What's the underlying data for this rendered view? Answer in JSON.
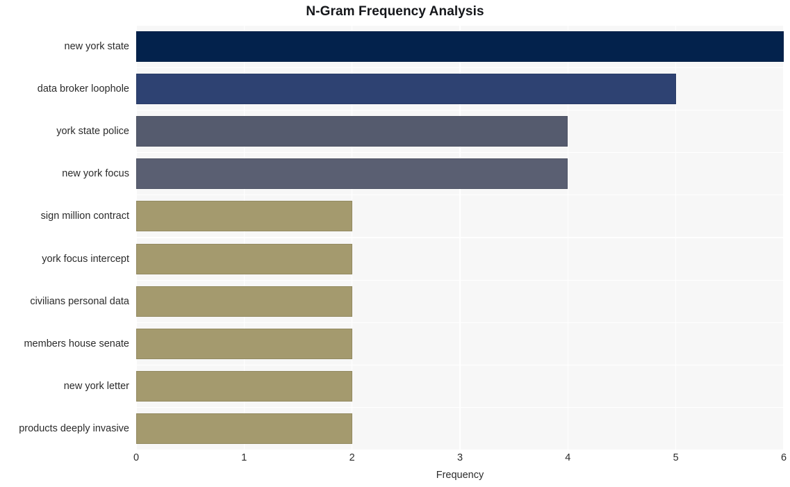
{
  "chart_data": {
    "type": "bar",
    "orientation": "horizontal",
    "title": "N-Gram Frequency Analysis",
    "xlabel": "Frequency",
    "ylabel": "",
    "categories": [
      "new york state",
      "data broker loophole",
      "york state police",
      "new york focus",
      "sign million contract",
      "york focus intercept",
      "civilians personal data",
      "members house senate",
      "new york letter",
      "products deeply invasive"
    ],
    "values": [
      6,
      5,
      4,
      4,
      2,
      2,
      2,
      2,
      2,
      2
    ],
    "bar_colors": [
      "#03224c",
      "#2e4272",
      "#555b6e",
      "#5a5f72",
      "#a49a6e",
      "#a49a6e",
      "#a49a6e",
      "#a49a6e",
      "#a49a6e",
      "#a49a6e"
    ],
    "xlim": [
      0,
      6
    ],
    "xticks": [
      0,
      1,
      2,
      3,
      4,
      5,
      6
    ],
    "xtick_labels": [
      "0",
      "1",
      "2",
      "3",
      "4",
      "5",
      "6"
    ],
    "grid": true,
    "legend": null,
    "plot_background": "#f7f7f7",
    "figure_background": "#ffffff",
    "gridline_color": "#ffffff"
  }
}
